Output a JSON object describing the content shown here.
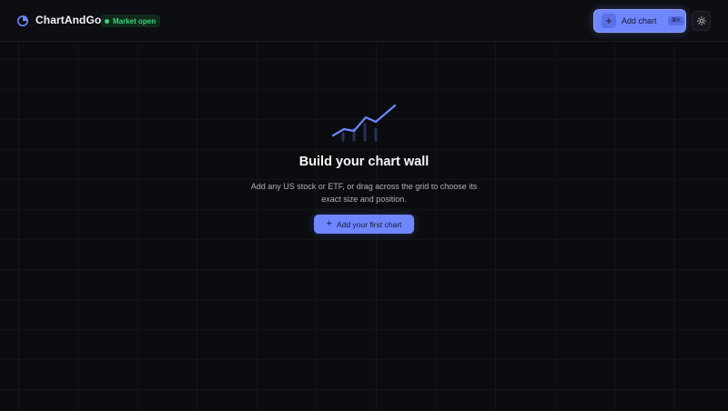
{
  "header": {
    "brand": "ChartAndGo",
    "logo_icon": "pie-chart-icon",
    "status_badge": "Market open",
    "status_color": "#3fd37a",
    "add_chart_label": "Add chart",
    "add_chart_shortcut": "⌘K",
    "theme_icon": "sun-icon"
  },
  "empty_state": {
    "illustration_icon": "chart-trend-icon",
    "title": "Build your chart wall",
    "description": "Add any US stock or ETF, or drag across the grid to choose its exact size and position.",
    "cta_label": "Add your first chart"
  },
  "colors": {
    "accent": "#6f86ff",
    "background": "#0b0c0f"
  }
}
